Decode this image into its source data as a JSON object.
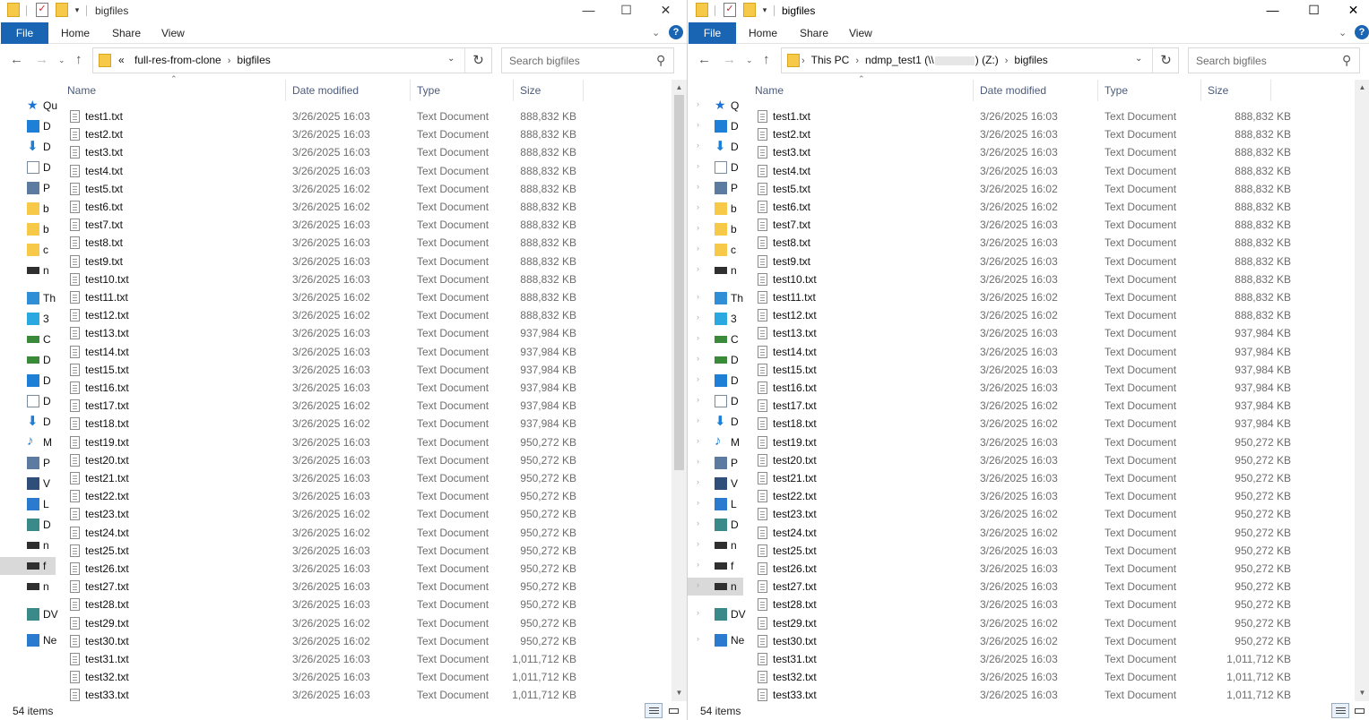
{
  "left": {
    "title": "bigfiles",
    "tabs": {
      "file": "File",
      "home": "Home",
      "share": "Share",
      "view": "View"
    },
    "breadcrumb": {
      "overflow": "«",
      "items": [
        "full-res-from-clone",
        "bigfiles"
      ]
    },
    "search_placeholder": "Search bigfiles",
    "columns": {
      "name": "Name",
      "date": "Date modified",
      "type": "Type",
      "size": "Size"
    },
    "status_count": "54 items",
    "nav_pane": [
      {
        "icon": "star-icon",
        "label": "Qu",
        "color": "#1a73d6"
      },
      {
        "icon": "desktop-icon",
        "label": "D",
        "color": "#1e7fd6"
      },
      {
        "icon": "download-icon",
        "label": "D",
        "color": "#1e7fd6"
      },
      {
        "icon": "document-icon",
        "label": "D",
        "color": "#7a8aa0"
      },
      {
        "icon": "pictures-icon",
        "label": "P",
        "color": "#5d7aa0"
      },
      {
        "icon": "folder-icon",
        "label": "b",
        "color": "#f7c948"
      },
      {
        "icon": "folder-icon",
        "label": "b",
        "color": "#f7c948"
      },
      {
        "icon": "folder-icon",
        "label": "c",
        "color": "#f7c948"
      },
      {
        "icon": "network-drive-icon",
        "label": "n",
        "color": "#2f2f2f"
      },
      {
        "icon": "this-pc-icon",
        "label": "Th",
        "color": "#2f8ed6"
      },
      {
        "icon": "3d-objects-icon",
        "label": "3",
        "color": "#2aa8e0"
      },
      {
        "icon": "network-drive-icon",
        "label": "C",
        "color": "#3a8a3a"
      },
      {
        "icon": "network-drive-icon",
        "label": "D",
        "color": "#3a8a3a"
      },
      {
        "icon": "desktop-icon",
        "label": "D",
        "color": "#1e7fd6"
      },
      {
        "icon": "document-icon",
        "label": "D",
        "color": "#7a8aa0"
      },
      {
        "icon": "download-icon",
        "label": "D",
        "color": "#1e7fd6"
      },
      {
        "icon": "music-icon",
        "label": "M",
        "color": "#1e7fd6"
      },
      {
        "icon": "pictures-icon",
        "label": "P",
        "color": "#5d7aa0"
      },
      {
        "icon": "videos-icon",
        "label": "V",
        "color": "#2f4f7a"
      },
      {
        "icon": "network-icon",
        "label": "L",
        "color": "#2a7ad0"
      },
      {
        "icon": "dvd-icon",
        "label": "D",
        "color": "#3a8a8a"
      },
      {
        "icon": "network-drive-icon",
        "label": "n",
        "color": "#2f2f2f"
      },
      {
        "icon": "network-drive-icon",
        "label": "f",
        "color": "#2f2f2f",
        "selected": true
      },
      {
        "icon": "network-drive-icon",
        "label": "n",
        "color": "#2f2f2f"
      },
      {
        "icon": "dvd-icon",
        "label": "DV",
        "color": "#3a8a8a"
      },
      {
        "icon": "network-icon",
        "label": "Ne",
        "color": "#2a7ad0"
      }
    ]
  },
  "right": {
    "title": "bigfiles",
    "tabs": {
      "file": "File",
      "home": "Home",
      "share": "Share",
      "view": "View"
    },
    "breadcrumb": {
      "items": [
        "This PC",
        "ndmp_test1 (\\\\",
        ") (Z:)",
        "bigfiles"
      ]
    },
    "search_placeholder": "Search bigfiles",
    "columns": {
      "name": "Name",
      "date": "Date modified",
      "type": "Type",
      "size": "Size"
    },
    "status_count": "54 items",
    "nav_pane": [
      {
        "icon": "star-icon",
        "label": "Q",
        "color": "#1a73d6"
      },
      {
        "icon": "desktop-icon",
        "label": "D",
        "color": "#1e7fd6"
      },
      {
        "icon": "download-icon",
        "label": "D",
        "color": "#1e7fd6"
      },
      {
        "icon": "document-icon",
        "label": "D",
        "color": "#7a8aa0"
      },
      {
        "icon": "pictures-icon",
        "label": "P",
        "color": "#5d7aa0"
      },
      {
        "icon": "folder-icon",
        "label": "b",
        "color": "#f7c948"
      },
      {
        "icon": "folder-icon",
        "label": "b",
        "color": "#f7c948"
      },
      {
        "icon": "folder-icon",
        "label": "c",
        "color": "#f7c948"
      },
      {
        "icon": "network-drive-icon",
        "label": "n",
        "color": "#2f2f2f"
      },
      {
        "icon": "this-pc-icon",
        "label": "Th",
        "color": "#2f8ed6"
      },
      {
        "icon": "3d-objects-icon",
        "label": "3",
        "color": "#2aa8e0"
      },
      {
        "icon": "network-drive-icon",
        "label": "C",
        "color": "#3a8a3a"
      },
      {
        "icon": "network-drive-icon",
        "label": "D",
        "color": "#3a8a3a"
      },
      {
        "icon": "desktop-icon",
        "label": "D",
        "color": "#1e7fd6"
      },
      {
        "icon": "document-icon",
        "label": "D",
        "color": "#7a8aa0"
      },
      {
        "icon": "download-icon",
        "label": "D",
        "color": "#1e7fd6"
      },
      {
        "icon": "music-icon",
        "label": "M",
        "color": "#1e7fd6"
      },
      {
        "icon": "pictures-icon",
        "label": "P",
        "color": "#5d7aa0"
      },
      {
        "icon": "videos-icon",
        "label": "V",
        "color": "#2f4f7a"
      },
      {
        "icon": "network-icon",
        "label": "L",
        "color": "#2a7ad0"
      },
      {
        "icon": "dvd-icon",
        "label": "D",
        "color": "#3a8a8a"
      },
      {
        "icon": "network-drive-icon",
        "label": "n",
        "color": "#2f2f2f"
      },
      {
        "icon": "network-drive-icon",
        "label": "f",
        "color": "#2f2f2f"
      },
      {
        "icon": "network-drive-icon",
        "label": "n",
        "color": "#2f2f2f",
        "selected": true
      },
      {
        "icon": "dvd-icon",
        "label": "DV",
        "color": "#3a8a8a"
      },
      {
        "icon": "network-icon",
        "label": "Ne",
        "color": "#2a7ad0"
      }
    ]
  },
  "files": [
    {
      "name": "test1.txt",
      "date": "3/26/2025 16:03",
      "type": "Text Document",
      "size": "888,832 KB"
    },
    {
      "name": "test2.txt",
      "date": "3/26/2025 16:03",
      "type": "Text Document",
      "size": "888,832 KB"
    },
    {
      "name": "test3.txt",
      "date": "3/26/2025 16:03",
      "type": "Text Document",
      "size": "888,832 KB"
    },
    {
      "name": "test4.txt",
      "date": "3/26/2025 16:03",
      "type": "Text Document",
      "size": "888,832 KB"
    },
    {
      "name": "test5.txt",
      "date": "3/26/2025 16:02",
      "type": "Text Document",
      "size": "888,832 KB"
    },
    {
      "name": "test6.txt",
      "date": "3/26/2025 16:02",
      "type": "Text Document",
      "size": "888,832 KB"
    },
    {
      "name": "test7.txt",
      "date": "3/26/2025 16:03",
      "type": "Text Document",
      "size": "888,832 KB"
    },
    {
      "name": "test8.txt",
      "date": "3/26/2025 16:03",
      "type": "Text Document",
      "size": "888,832 KB"
    },
    {
      "name": "test9.txt",
      "date": "3/26/2025 16:03",
      "type": "Text Document",
      "size": "888,832 KB"
    },
    {
      "name": "test10.txt",
      "date": "3/26/2025 16:03",
      "type": "Text Document",
      "size": "888,832 KB"
    },
    {
      "name": "test11.txt",
      "date": "3/26/2025 16:02",
      "type": "Text Document",
      "size": "888,832 KB"
    },
    {
      "name": "test12.txt",
      "date": "3/26/2025 16:02",
      "type": "Text Document",
      "size": "888,832 KB"
    },
    {
      "name": "test13.txt",
      "date": "3/26/2025 16:03",
      "type": "Text Document",
      "size": "937,984 KB"
    },
    {
      "name": "test14.txt",
      "date": "3/26/2025 16:03",
      "type": "Text Document",
      "size": "937,984 KB"
    },
    {
      "name": "test15.txt",
      "date": "3/26/2025 16:03",
      "type": "Text Document",
      "size": "937,984 KB"
    },
    {
      "name": "test16.txt",
      "date": "3/26/2025 16:03",
      "type": "Text Document",
      "size": "937,984 KB"
    },
    {
      "name": "test17.txt",
      "date": "3/26/2025 16:02",
      "type": "Text Document",
      "size": "937,984 KB"
    },
    {
      "name": "test18.txt",
      "date": "3/26/2025 16:02",
      "type": "Text Document",
      "size": "937,984 KB"
    },
    {
      "name": "test19.txt",
      "date": "3/26/2025 16:03",
      "type": "Text Document",
      "size": "950,272 KB"
    },
    {
      "name": "test20.txt",
      "date": "3/26/2025 16:03",
      "type": "Text Document",
      "size": "950,272 KB"
    },
    {
      "name": "test21.txt",
      "date": "3/26/2025 16:03",
      "type": "Text Document",
      "size": "950,272 KB"
    },
    {
      "name": "test22.txt",
      "date": "3/26/2025 16:03",
      "type": "Text Document",
      "size": "950,272 KB"
    },
    {
      "name": "test23.txt",
      "date": "3/26/2025 16:02",
      "type": "Text Document",
      "size": "950,272 KB"
    },
    {
      "name": "test24.txt",
      "date": "3/26/2025 16:02",
      "type": "Text Document",
      "size": "950,272 KB"
    },
    {
      "name": "test25.txt",
      "date": "3/26/2025 16:03",
      "type": "Text Document",
      "size": "950,272 KB"
    },
    {
      "name": "test26.txt",
      "date": "3/26/2025 16:03",
      "type": "Text Document",
      "size": "950,272 KB"
    },
    {
      "name": "test27.txt",
      "date": "3/26/2025 16:03",
      "type": "Text Document",
      "size": "950,272 KB"
    },
    {
      "name": "test28.txt",
      "date": "3/26/2025 16:03",
      "type": "Text Document",
      "size": "950,272 KB"
    },
    {
      "name": "test29.txt",
      "date": "3/26/2025 16:02",
      "type": "Text Document",
      "size": "950,272 KB"
    },
    {
      "name": "test30.txt",
      "date": "3/26/2025 16:02",
      "type": "Text Document",
      "size": "950,272 KB"
    },
    {
      "name": "test31.txt",
      "date": "3/26/2025 16:03",
      "type": "Text Document",
      "size": "1,011,712 KB"
    },
    {
      "name": "test32.txt",
      "date": "3/26/2025 16:03",
      "type": "Text Document",
      "size": "1,011,712 KB"
    },
    {
      "name": "test33.txt",
      "date": "3/26/2025 16:03",
      "type": "Text Document",
      "size": "1,011,712 KB"
    }
  ],
  "glyphs": {
    "minimize": "—",
    "maximize": "☐",
    "close": "✕",
    "back": "←",
    "forward": "→",
    "recent": "⌄",
    "up": "↑",
    "refresh": "↻",
    "search": "⚲",
    "crumb_sep": "›",
    "dropdown": "⌄",
    "ribbon_expand": "⌄",
    "help": "?",
    "sort_up": "⌃",
    "scroll_up": "▲",
    "scroll_down": "▼",
    "qa_dropdown": "▾"
  }
}
